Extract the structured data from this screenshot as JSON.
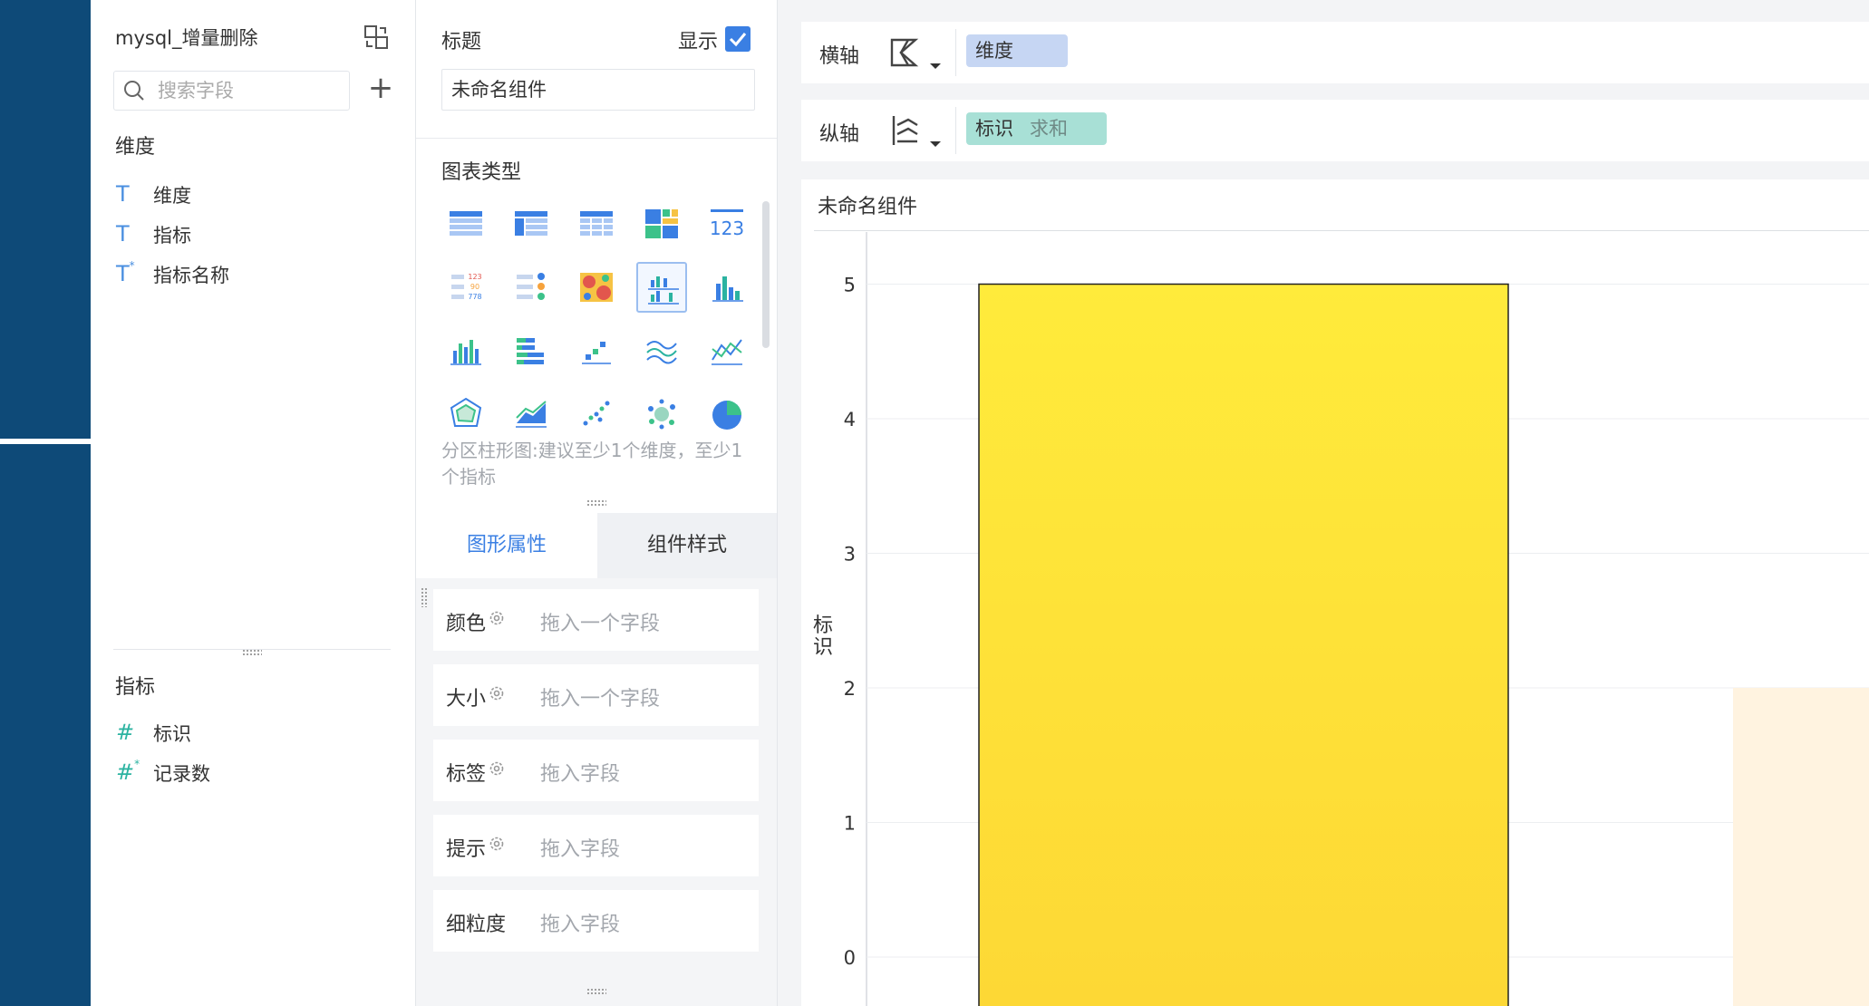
{
  "field_panel": {
    "dataset_name": "mysql_增量删除",
    "search": {
      "placeholder": "搜索字段"
    },
    "dimensions": {
      "title": "维度",
      "items": [
        {
          "label": "维度",
          "icon": "text-type-icon"
        },
        {
          "label": "指标",
          "icon": "text-type-icon"
        },
        {
          "label": "指标名称",
          "icon": "text-type-calc-icon"
        }
      ]
    },
    "measures": {
      "title": "指标",
      "items": [
        {
          "label": "标识",
          "icon": "number-type-icon"
        },
        {
          "label": "记录数",
          "icon": "number-type-calc-icon"
        }
      ]
    }
  },
  "config_panel": {
    "title_label": "标题",
    "show_label": "显示",
    "show_checked": true,
    "title_value": "未命名组件",
    "chart_type_label": "图表类型",
    "chart_type_hint": "分区柱形图:建议至少1个维度，至少1个指标",
    "tabs": {
      "shape": "图形属性",
      "style": "组件样式"
    },
    "properties": [
      {
        "label": "颜色",
        "has_gear": true,
        "drop": "拖入一个字段"
      },
      {
        "label": "大小",
        "has_gear": true,
        "drop": "拖入一个字段"
      },
      {
        "label": "标签",
        "has_gear": true,
        "drop": "拖入字段"
      },
      {
        "label": "提示",
        "has_gear": true,
        "drop": "拖入字段"
      },
      {
        "label": "细粒度",
        "has_gear": false,
        "drop": "拖入字段"
      }
    ]
  },
  "axes": {
    "x": {
      "label": "横轴",
      "pill": "维度"
    },
    "y": {
      "label": "纵轴",
      "pill": "标识",
      "aggregation": "求和"
    }
  },
  "chart": {
    "title": "未命名组件"
  },
  "colors": {
    "accent": "#3a7fe3",
    "bar_top": "#ffeb3b",
    "bar_bottom": "#fdd835",
    "bar_secondary": "#fff3e0",
    "sidebar_dark": "#0e4a78"
  },
  "chart_data": {
    "type": "bar",
    "title": "",
    "ylabel": "标识",
    "ylim": [
      0,
      6
    ],
    "yticks": [
      0,
      1,
      2,
      3,
      4,
      5,
      6
    ],
    "grid": true,
    "series": [
      {
        "values": [
          5,
          2
        ]
      }
    ]
  }
}
